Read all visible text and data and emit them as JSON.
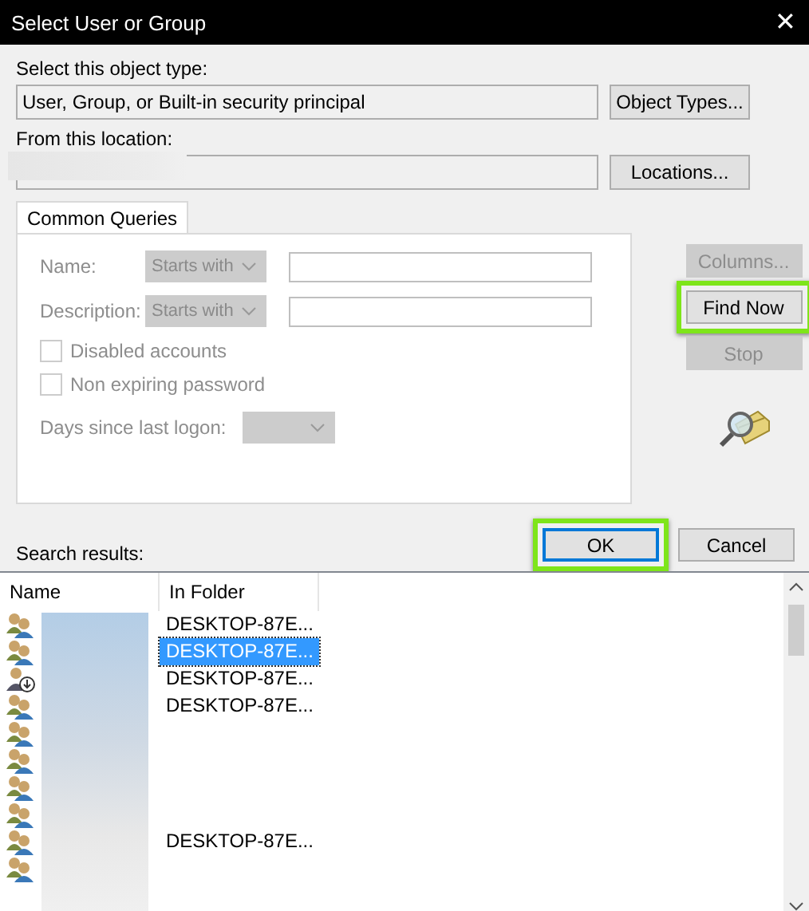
{
  "window": {
    "title": "Select User or Group",
    "close": "✕"
  },
  "object_type": {
    "label": "Select this object type:",
    "value": "User, Group, or Built-in security principal",
    "button": "Object Types..."
  },
  "location": {
    "label": "From this location:",
    "button": "Locations..."
  },
  "tabs": [
    {
      "label": "Common Queries",
      "selected": true
    }
  ],
  "queries": {
    "name_label": "Name:",
    "name_mode": "Starts with",
    "description_label": "Description:",
    "description_mode": "Starts with",
    "checkboxes": [
      {
        "label": "Disabled accounts",
        "checked": false
      },
      {
        "label": "Non expiring password",
        "checked": false
      }
    ],
    "days_label": "Days since last logon:"
  },
  "side_buttons": [
    {
      "label": "Columns...",
      "disabled": true,
      "highlighted": false
    },
    {
      "label": "Find Now",
      "disabled": false,
      "highlighted": true
    },
    {
      "label": "Stop",
      "disabled": true,
      "highlighted": false
    }
  ],
  "dialog_buttons": [
    {
      "label": "OK",
      "default": true,
      "highlighted": true
    },
    {
      "label": "Cancel",
      "default": false,
      "highlighted": false
    }
  ],
  "results": {
    "label": "Search results:",
    "columns": [
      "Name",
      "In Folder"
    ],
    "rows": [
      {
        "kind": "group",
        "folder": "DESKTOP-87E...",
        "selected": false
      },
      {
        "kind": "group",
        "folder": "DESKTOP-87E...",
        "selected": true
      },
      {
        "kind": "user",
        "folder": "DESKTOP-87E...",
        "selected": false
      },
      {
        "kind": "group",
        "folder": "DESKTOP-87E...",
        "selected": false
      },
      {
        "kind": "group",
        "selected": false
      },
      {
        "kind": "group",
        "selected": false
      },
      {
        "kind": "group",
        "selected": false
      },
      {
        "kind": "group",
        "selected": false
      },
      {
        "kind": "group",
        "folder": "DESKTOP-87E...",
        "selected": false
      },
      {
        "kind": "group",
        "selected": false
      }
    ]
  }
}
